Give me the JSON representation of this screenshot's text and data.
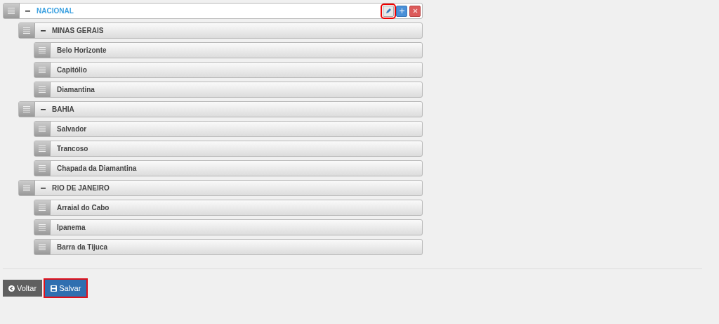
{
  "tree": [
    {
      "label": "NACIONAL",
      "selected": true,
      "expanded": true,
      "actions": [
        {
          "kind": "edit",
          "highlighted": true
        },
        {
          "kind": "add",
          "highlighted": false
        },
        {
          "kind": "remove",
          "highlighted": false
        }
      ],
      "children": [
        {
          "label": "MINAS GERAIS",
          "selected": false,
          "expanded": true,
          "children": [
            {
              "label": "Belo Horizonte",
              "selected": false
            },
            {
              "label": "Capitólio",
              "selected": false
            },
            {
              "label": "Diamantina",
              "selected": false
            }
          ]
        },
        {
          "label": "BAHIA",
          "selected": false,
          "expanded": true,
          "children": [
            {
              "label": "Salvador",
              "selected": false
            },
            {
              "label": "Trancoso",
              "selected": false
            },
            {
              "label": "Chapada da Diamantina",
              "selected": false
            }
          ]
        },
        {
          "label": "RIO DE JANEIRO",
          "selected": false,
          "expanded": true,
          "children": [
            {
              "label": "Arraial do Cabo",
              "selected": false
            },
            {
              "label": "Ipanema",
              "selected": false
            },
            {
              "label": "Barra da Tijuca",
              "selected": false
            }
          ]
        }
      ]
    }
  ],
  "buttons": [
    {
      "kind": "back",
      "label": "Voltar",
      "highlighted": false
    },
    {
      "kind": "save",
      "label": "Salvar",
      "highlighted": true
    }
  ]
}
